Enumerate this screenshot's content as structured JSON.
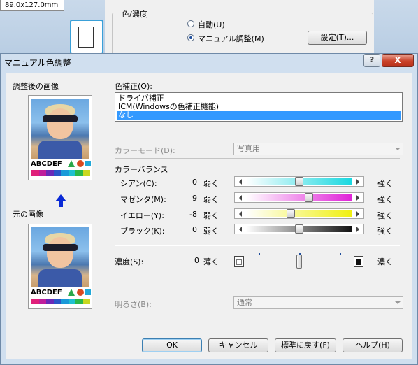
{
  "background_window": {
    "paper_size_value": "89.0x127.0mm",
    "color_density_group_label": "色/濃度",
    "auto_radio_label": "自動(U)",
    "manual_radio_label": "マニュアル調整(M)",
    "settings_button_label": "設定(T)..."
  },
  "dialog": {
    "title": "マニュアル色調整",
    "help_label": "?",
    "close_label": "X"
  },
  "preview": {
    "adjusted_label": "調整後の画像",
    "original_label": "元の画像",
    "sample_text": "ABCDEF"
  },
  "color_correction": {
    "label": "色補正(O):",
    "options": [
      "ドライバ補正",
      "ICM(Windowsの色補正機能)",
      "なし"
    ],
    "selected_index": 2
  },
  "color_mode": {
    "label": "カラーモード(D):",
    "value": "写真用"
  },
  "color_balance": {
    "label": "カラーバランス",
    "rows": [
      {
        "label": "シアン(C):",
        "value": "0",
        "left": "弱く",
        "right": "強く",
        "level": 0,
        "color": "#18d8e0"
      },
      {
        "label": "マゼンタ(M):",
        "value": "9",
        "left": "弱く",
        "right": "強く",
        "level": 9,
        "color": "#e022d8"
      },
      {
        "label": "イエロー(Y):",
        "value": "-8",
        "left": "弱く",
        "right": "強く",
        "level": -8,
        "color": "#f0f010"
      },
      {
        "label": "ブラック(K):",
        "value": "0",
        "left": "弱く",
        "right": "強く",
        "level": 0,
        "color": "#111111"
      }
    ]
  },
  "density": {
    "label": "濃度(S):",
    "value": "0",
    "left": "薄く",
    "right": "濃く",
    "level": 0
  },
  "brightness": {
    "label": "明るさ(B):",
    "value": "通常"
  },
  "buttons": {
    "ok": "OK",
    "cancel": "キャンセル",
    "default": "標準に戻す(F)",
    "help": "ヘルプ(H)"
  },
  "swatch_colors": [
    "#e0207a",
    "#c01e9c",
    "#6a2ab8",
    "#2a56c8",
    "#1a9ad8",
    "#20c0d0",
    "#2ab84a",
    "#c8d820"
  ]
}
